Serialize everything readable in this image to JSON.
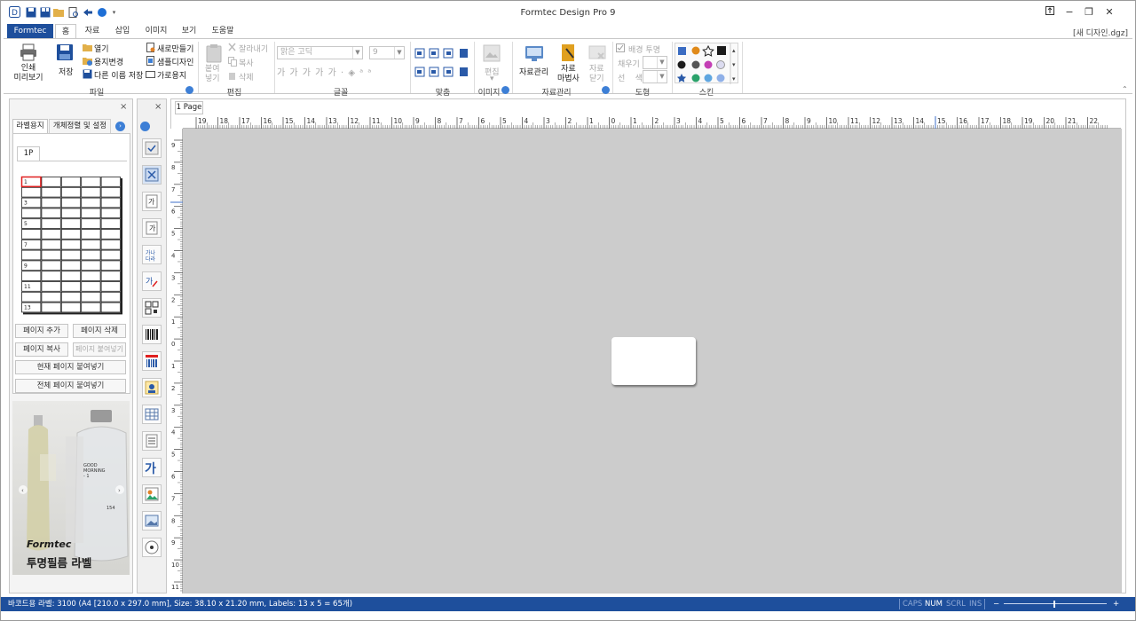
{
  "window": {
    "title": "Formtec Design Pro 9",
    "doc_name": "[새 디자인.dgz]",
    "controls": [
      "?",
      "−",
      "❐",
      "✕"
    ]
  },
  "tabs": {
    "file": "Formtec",
    "home": "홈",
    "data": "자료",
    "insert": "삽입",
    "image": "이미지",
    "view": "보기",
    "help": "도움말"
  },
  "ribbon": {
    "file_group": {
      "print_preview": "인쇄\n미리보기",
      "save": "저장",
      "open": "열기",
      "change_paper": "용지변경",
      "save_as": "다른 이름 저장",
      "new_make": "새로만들기",
      "sample_design": "샘플디자인",
      "landscape": "가로용지",
      "label": "파일"
    },
    "edit_group": {
      "paste": "붙여\n넣기",
      "cut": "잘라내기",
      "copy": "복사",
      "delete": "삭제",
      "label": "편집"
    },
    "font_group": {
      "font_name": "맑은 고딕",
      "font_size": "9",
      "styles": [
        "가",
        "가",
        "가",
        "가",
        "가"
      ],
      "label": "글꼴"
    },
    "align_group": {
      "label": "맞춤"
    },
    "image_group": {
      "edit": "편집",
      "label": "이미지"
    },
    "data_group": {
      "data_manage": "자료관리",
      "data_wizard": "자료\n마법사",
      "data_close": "자료\n닫기",
      "label": "자료관리"
    },
    "shape_group": {
      "bg_transparent": "배경 투명",
      "fill": "채우기",
      "line_color": "선    색",
      "label": "도형"
    },
    "skin_group": {
      "label": "스킨"
    }
  },
  "left_panel": {
    "tabs": [
      "라벨용지",
      "개체정렬 및 설정"
    ],
    "page_tab": "1P",
    "label_numbers": [
      "1",
      "3",
      "5",
      "7",
      "9",
      "11",
      "13"
    ],
    "buttons": {
      "add_page": "페이지 추가",
      "delete_page": "페이지 삭제",
      "copy_page": "페이지 복사",
      "paste_page": "페이지 붙여넣기",
      "paste_current": "현재 페이지 붙여넣기",
      "paste_all": "전체 페이지 붙여넣기"
    },
    "ad": {
      "brand": "Formtec",
      "title": "투명필름 라벨",
      "bottle_text": [
        "GOOD",
        "MORNING",
        "- 1",
        "154"
      ]
    }
  },
  "canvas": {
    "page_tab": "1 Page",
    "ruler_h": [
      "19",
      "18",
      "17",
      "16",
      "15",
      "14",
      "13",
      "12",
      "11",
      "10",
      "9",
      "8",
      "7",
      "6",
      "5",
      "4",
      "3",
      "2",
      "1",
      "0",
      "1",
      "2",
      "3",
      "4",
      "5",
      "6",
      "7",
      "8",
      "9",
      "10",
      "11",
      "12",
      "13",
      "14",
      "15",
      "16",
      "17",
      "18",
      "19",
      "20",
      "21",
      "22"
    ],
    "ruler_v": [
      "9",
      "8",
      "7",
      "6",
      "5",
      "4",
      "3",
      "2",
      "1",
      "0",
      "1",
      "2",
      "3",
      "4",
      "5",
      "6",
      "7",
      "8",
      "9",
      "10",
      "11"
    ]
  },
  "status": {
    "info": "바코드용 라벨: 3100 (A4 [210.0 x 297.0 mm], Size: 38.10 x 21.20 mm,  Labels: 13 x 5 = 65개)",
    "caps": "CAPS",
    "num": "NUM",
    "scrl": "SCRL",
    "ins": "INS",
    "zoom_minus": "−",
    "zoom_plus": "+"
  },
  "colors": {
    "accent": "#1e4f9c",
    "workspace": "#cccccc",
    "selected_label": "#e02020"
  }
}
